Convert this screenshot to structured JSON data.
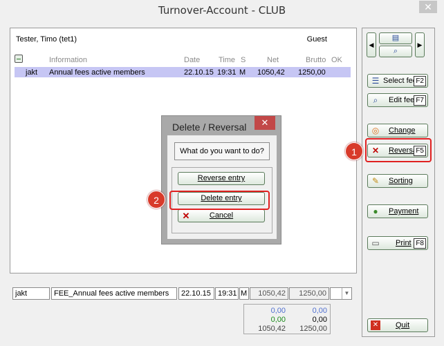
{
  "window": {
    "title": "Turnover-Account - CLUB",
    "close": "✕"
  },
  "customer": {
    "name": "Tester, Timo (tet1)",
    "status": "Guest"
  },
  "table": {
    "headers": {
      "information": "Information",
      "date": "Date",
      "time": "Time",
      "s": "S",
      "net": "Net",
      "brutto": "Brutto",
      "ok": "OK"
    },
    "rows": [
      {
        "code": "jakt",
        "information": "Annual fees active members",
        "date": "22.10.15",
        "time": "19:31",
        "s": "M",
        "net": "1050,42",
        "brutto": "1250,00"
      }
    ]
  },
  "dialog": {
    "title": "Delete / Reversal",
    "close": "✕",
    "question": "What do you want to do?",
    "reverse_label": "Reverse entry",
    "delete_label": "Delete entry",
    "cancel_label": "Cancel"
  },
  "sidebar": {
    "select_fee": {
      "label": "Select fee",
      "key": "F2"
    },
    "edit_fee": {
      "label": "Edit fee",
      "key": "F7"
    },
    "change": {
      "label": "Change"
    },
    "reversal": {
      "label": "Reversal",
      "key": "F5"
    },
    "sorting": {
      "label": "Sorting"
    },
    "payment": {
      "label": "Payment"
    },
    "print": {
      "label": "Print",
      "key": "F8"
    },
    "quit": {
      "label": "Quit"
    }
  },
  "bottom": {
    "code": "jakt",
    "fee": "FEE_Annual fees active members",
    "date": "22.10.15",
    "time": "19:31",
    "s": "M",
    "net": "1050,42",
    "brutto": "1250,00",
    "totals": {
      "net_blue": "0,00",
      "brutto_blue": "0,00",
      "net_green": "0,00",
      "brutto_black": "0,00",
      "net_sum": "1050,42",
      "brutto_sum": "1250,00"
    }
  },
  "annotations": {
    "step1": "1",
    "step2": "2"
  },
  "colors": {
    "selection": "#c6c6f4",
    "callout": "#e02020",
    "badge": "#d83a2a"
  }
}
